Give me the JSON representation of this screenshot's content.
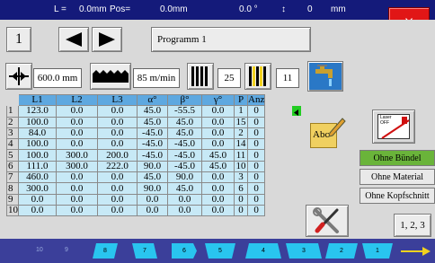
{
  "status_bar": {
    "l_label": "L =",
    "l_value": "0.0mm",
    "pos_label": "Pos=",
    "pos_value": "0.0mm",
    "angle_value": "0.0 °",
    "arrow_symbol": "↕",
    "z_value": "0",
    "z_unit": "mm"
  },
  "close_button": {
    "label": "X"
  },
  "navigation": {
    "program_number": "1",
    "program_name": "Programm 1"
  },
  "params": {
    "length_value": "600.0 mm",
    "speed_value": "85  m/min",
    "blade_count": "25",
    "piece_count": "11"
  },
  "table": {
    "headers": [
      "L1",
      "L2",
      "L3",
      "α°",
      "β°",
      "γ°",
      "P",
      "Anz"
    ],
    "rows": [
      {
        "n": "1",
        "cells": [
          "123.0",
          "0.0",
          "0.0",
          "45.0",
          "-55.5",
          "0.0",
          "1",
          "0"
        ]
      },
      {
        "n": "2",
        "cells": [
          "100.0",
          "0.0",
          "0.0",
          "45.0",
          "45.0",
          "0.0",
          "15",
          "0"
        ]
      },
      {
        "n": "3",
        "cells": [
          "84.0",
          "0.0",
          "0.0",
          "-45.0",
          "45.0",
          "0.0",
          "2",
          "0"
        ]
      },
      {
        "n": "4",
        "cells": [
          "100.0",
          "0.0",
          "0.0",
          "-45.0",
          "-45.0",
          "0.0",
          "14",
          "0"
        ]
      },
      {
        "n": "5",
        "cells": [
          "100.0",
          "300.0",
          "200.0",
          "-45.0",
          "-45.0",
          "45.0",
          "11",
          "0"
        ]
      },
      {
        "n": "6",
        "cells": [
          "111.0",
          "300.0",
          "222.0",
          "90.0",
          "-45.0",
          "45.0",
          "10",
          "0"
        ]
      },
      {
        "n": "7",
        "cells": [
          "460.0",
          "0.0",
          "0.0",
          "45.0",
          "90.0",
          "0.0",
          "3",
          "0"
        ]
      },
      {
        "n": "8",
        "cells": [
          "300.0",
          "0.0",
          "0.0",
          "90.0",
          "45.0",
          "0.0",
          "6",
          "0"
        ]
      },
      {
        "n": "9",
        "cells": [
          "0.0",
          "0.0",
          "0.0",
          "0.0",
          "0.0",
          "0.0",
          "0",
          "0"
        ]
      },
      {
        "n": "10",
        "cells": [
          "0.0",
          "0.0",
          "0.0",
          "0.0",
          "0.0",
          "0.0",
          "0",
          "0"
        ]
      }
    ]
  },
  "laser_button": {
    "line1": "Laser",
    "line2": "OFF"
  },
  "edit_button": {
    "label": "Abc"
  },
  "side_buttons": {
    "ohne_buendel": "Ohne Bündel",
    "ohne_material": "Ohne Material",
    "ohne_kopfschnitt": "Ohne Kopfschnitt",
    "sequence": "1, 2, 3"
  },
  "tape": {
    "marks": [
      "8",
      "7",
      "6",
      "5",
      "4",
      "3",
      "2",
      "1"
    ],
    "faded_numbers": [
      "10",
      "9"
    ]
  },
  "colors": {
    "status_bar": "#141a7a",
    "close_button": "#e11616",
    "table_header": "#5ea8e0",
    "table_cell": "#c7e9f6",
    "active_option": "#6ab43a",
    "tape_mark": "#29c5ef",
    "row_marker": "#22cc22"
  }
}
